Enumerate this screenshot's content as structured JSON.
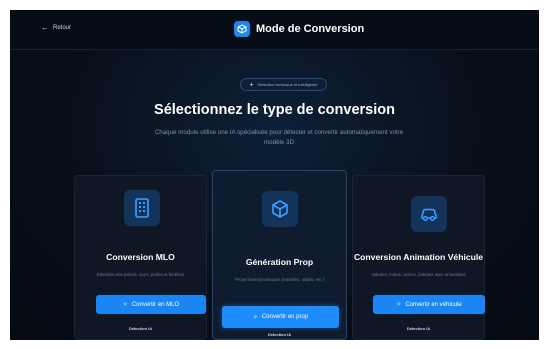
{
  "header": {
    "back_label": "Retour",
    "title": "Mode de Conversion"
  },
  "hero": {
    "pill_label": "Détection technique et intelligente",
    "heading": "Sélectionnez le type de conversion",
    "subtitle": "Chaque module utilise une IA spécialisée pour détecter et convertir automatiquement votre modèle 3D"
  },
  "cards": [
    {
      "title": "Conversion MLO",
      "description": "Détection des pièces, murs, portes et fenêtres",
      "button_label": "Convertir en MLO",
      "tag": "Détection IA",
      "icon": "building-icon"
    },
    {
      "title": "Génération Prop",
      "description": "Props fixes/dynamiques (meubles, objets, etc.)",
      "button_label": "Convertir en prop",
      "tag": "Détection IA",
      "icon": "box-icon"
    },
    {
      "title": "Conversion Animation Véhicule",
      "description": "Voitures, motos, avions, bateaux avec animations",
      "button_label": "Convertir en véhicule",
      "tag": "Détection IA",
      "icon": "car-icon"
    }
  ],
  "colors": {
    "accent": "#1a86f3",
    "background": "#080f1a",
    "card": "#0f1724"
  }
}
